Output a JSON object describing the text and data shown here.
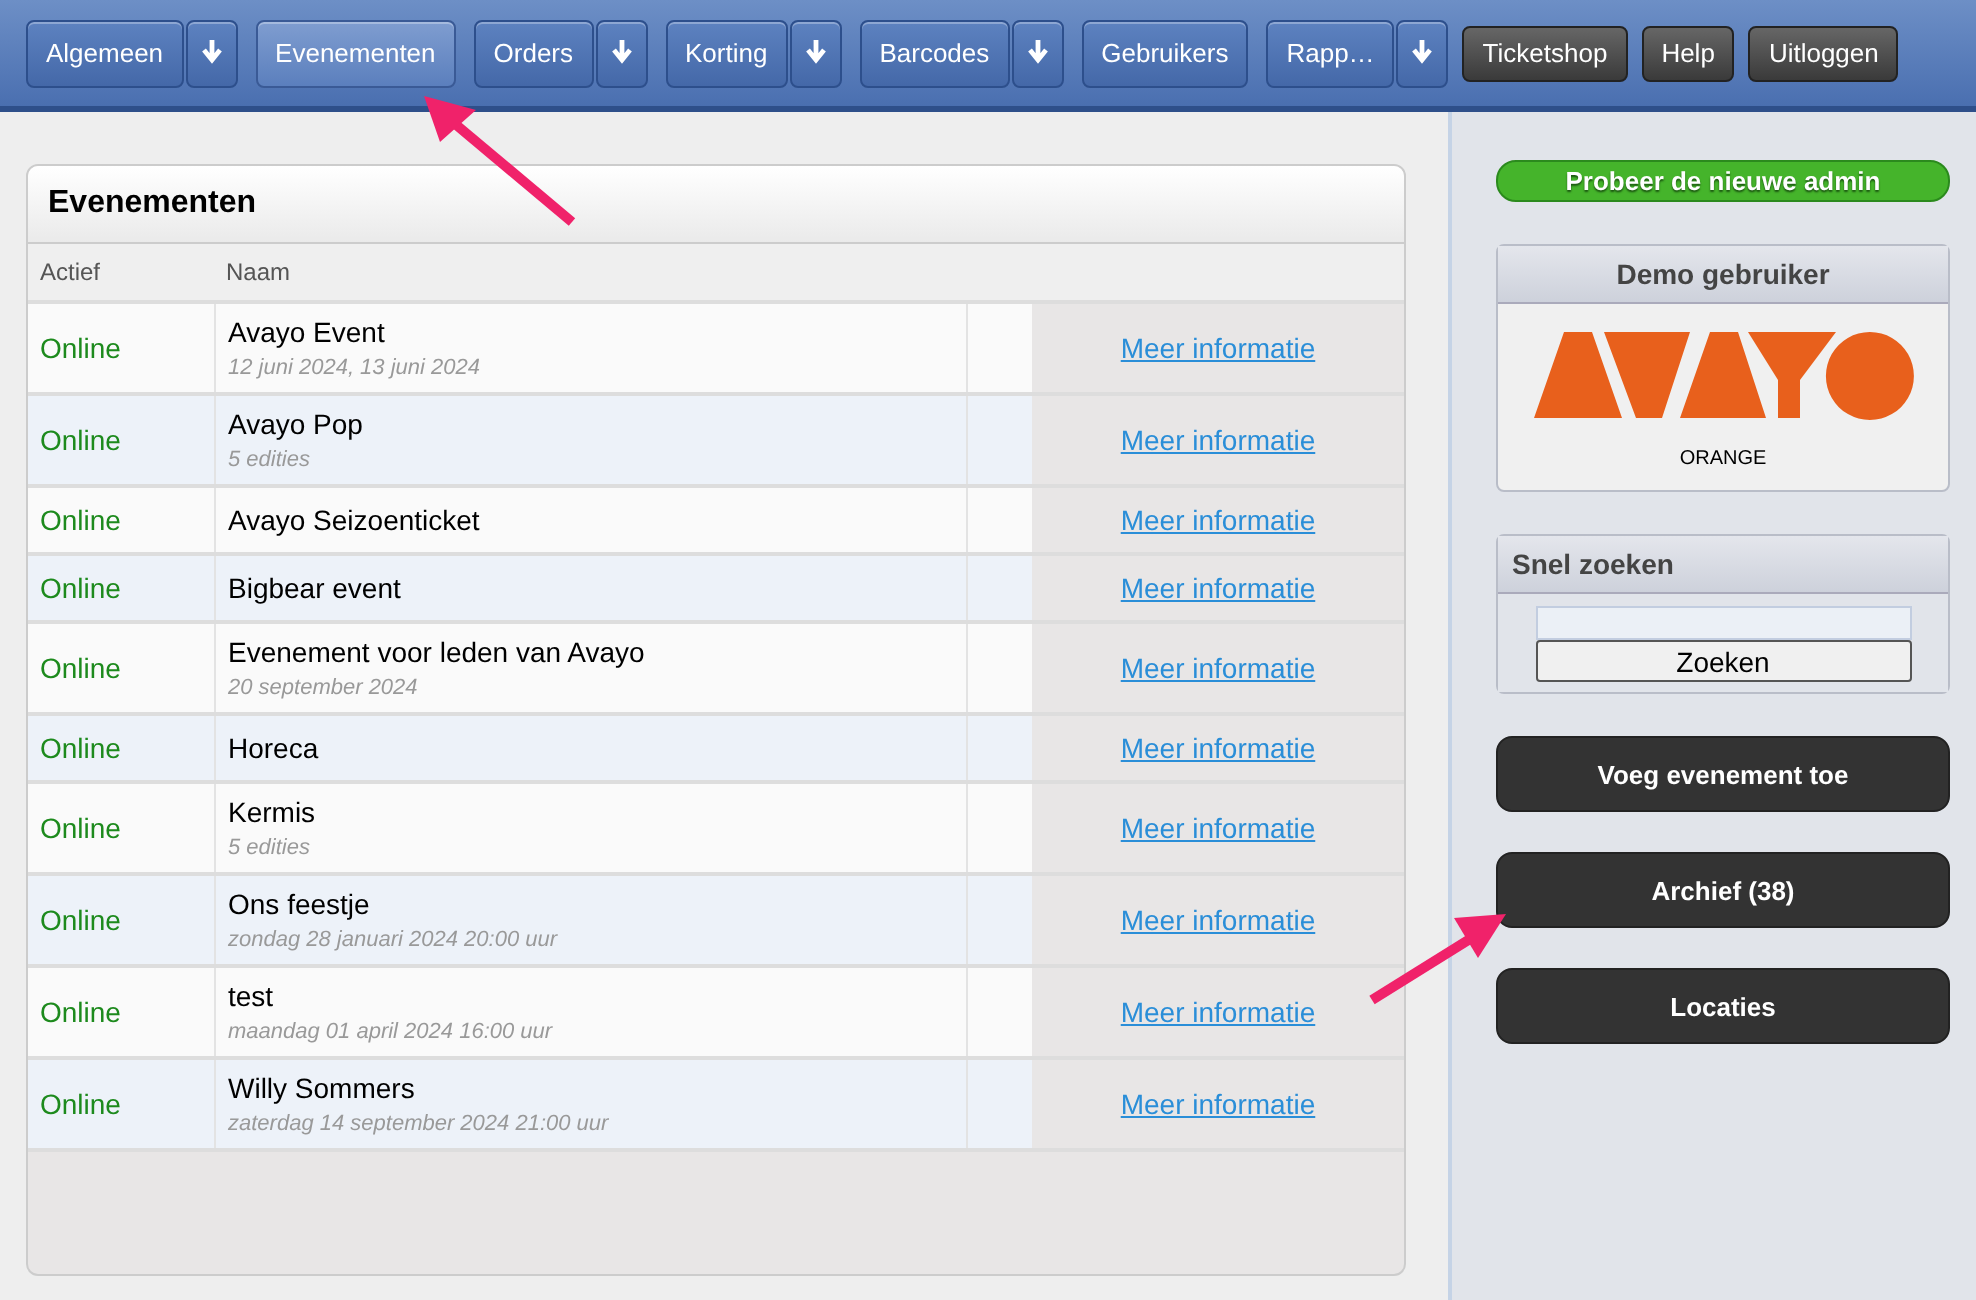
{
  "nav": [
    {
      "label": "Algemeen",
      "dropdown": true,
      "selected": false
    },
    {
      "label": "Evenementen",
      "dropdown": false,
      "selected": true
    },
    {
      "label": "Orders",
      "dropdown": true,
      "selected": false
    },
    {
      "label": "Korting",
      "dropdown": true,
      "selected": false
    },
    {
      "label": "Barcodes",
      "dropdown": true,
      "selected": false
    },
    {
      "label": "Gebruikers",
      "dropdown": false,
      "selected": false
    },
    {
      "label": "Rapp…",
      "dropdown": true,
      "selected": false
    }
  ],
  "nav_actions": [
    "Ticketshop",
    "Help",
    "Uitloggen"
  ],
  "panel": {
    "title": "Evenementen",
    "columns": [
      "Actief",
      "Naam"
    ],
    "rows": [
      {
        "status": "Online",
        "name": "Avayo Event",
        "detail": "12 juni 2024, 13 juni 2024",
        "link": "Meer informatie"
      },
      {
        "status": "Online",
        "name": "Avayo Pop",
        "detail": "5 edities",
        "link": "Meer informatie"
      },
      {
        "status": "Online",
        "name": "Avayo Seizoenticket",
        "link": "Meer informatie"
      },
      {
        "status": "Online",
        "name": "Bigbear event",
        "link": "Meer informatie"
      },
      {
        "status": "Online",
        "name": "Evenement voor leden van Avayo",
        "detail": "20 september 2024",
        "link": "Meer informatie"
      },
      {
        "status": "Online",
        "name": "Horeca",
        "link": "Meer informatie"
      },
      {
        "status": "Online",
        "name": "Kermis",
        "detail": "5 edities",
        "link": "Meer informatie"
      },
      {
        "status": "Online",
        "name": "Ons feestje",
        "detail": "zondag 28 januari 2024 20:00 uur",
        "link": "Meer informatie"
      },
      {
        "status": "Online",
        "name": "test",
        "detail": "maandag 01 april 2024 16:00 uur",
        "link": "Meer informatie"
      },
      {
        "status": "Online",
        "name": "Willy Sommers",
        "detail": "zaterdag 14 september 2024 21:00 uur",
        "link": "Meer informatie"
      }
    ]
  },
  "sidebar": {
    "new_admin": "Probeer de nieuwe admin",
    "user_box": {
      "title": "Demo gebruiker",
      "caption": "ORANGE"
    },
    "search_box": {
      "title": "Snel zoeken",
      "button": "Zoeken"
    },
    "actions": [
      "Voeg evenement toe",
      "Archief (38)",
      "Locaties"
    ]
  }
}
